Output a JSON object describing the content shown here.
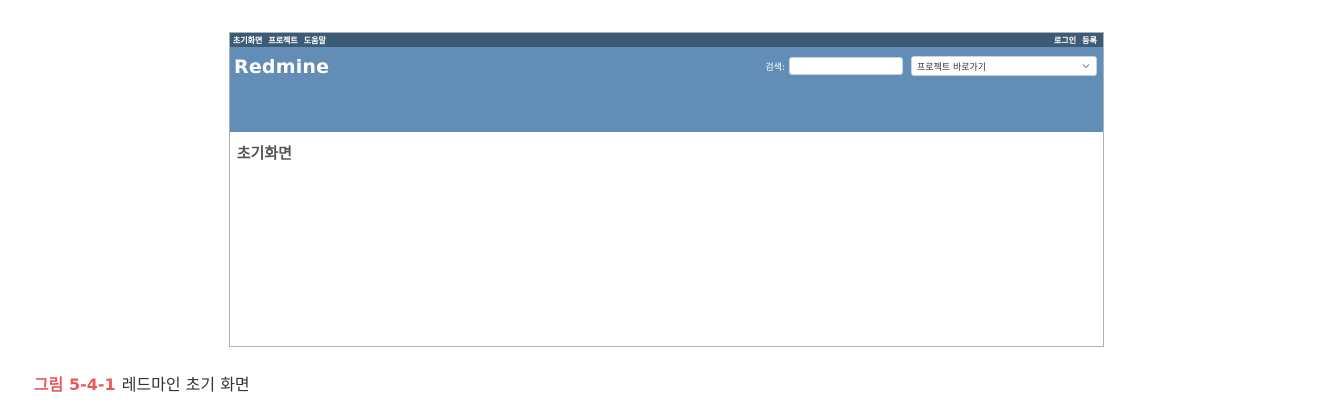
{
  "top_menu": {
    "left_items": [
      "초기화면",
      "프로젝트",
      "도움말"
    ],
    "right_items": [
      "로그인",
      "등록"
    ]
  },
  "header": {
    "site_title": "Redmine",
    "search_label": "검색:",
    "search_value": "",
    "jump_select_value": "프로젝트 바로가기"
  },
  "main": {
    "page_title": "초기화면"
  },
  "caption": {
    "label": "그림 5-4-1",
    "text": "레드마인 초기 화면"
  },
  "colors": {
    "top_menu_bg": "#3e5b76",
    "header_bg": "#628db6",
    "caption_label": "#e85a5a"
  },
  "icons": {
    "select_arrow": "chevron-down-icon"
  }
}
